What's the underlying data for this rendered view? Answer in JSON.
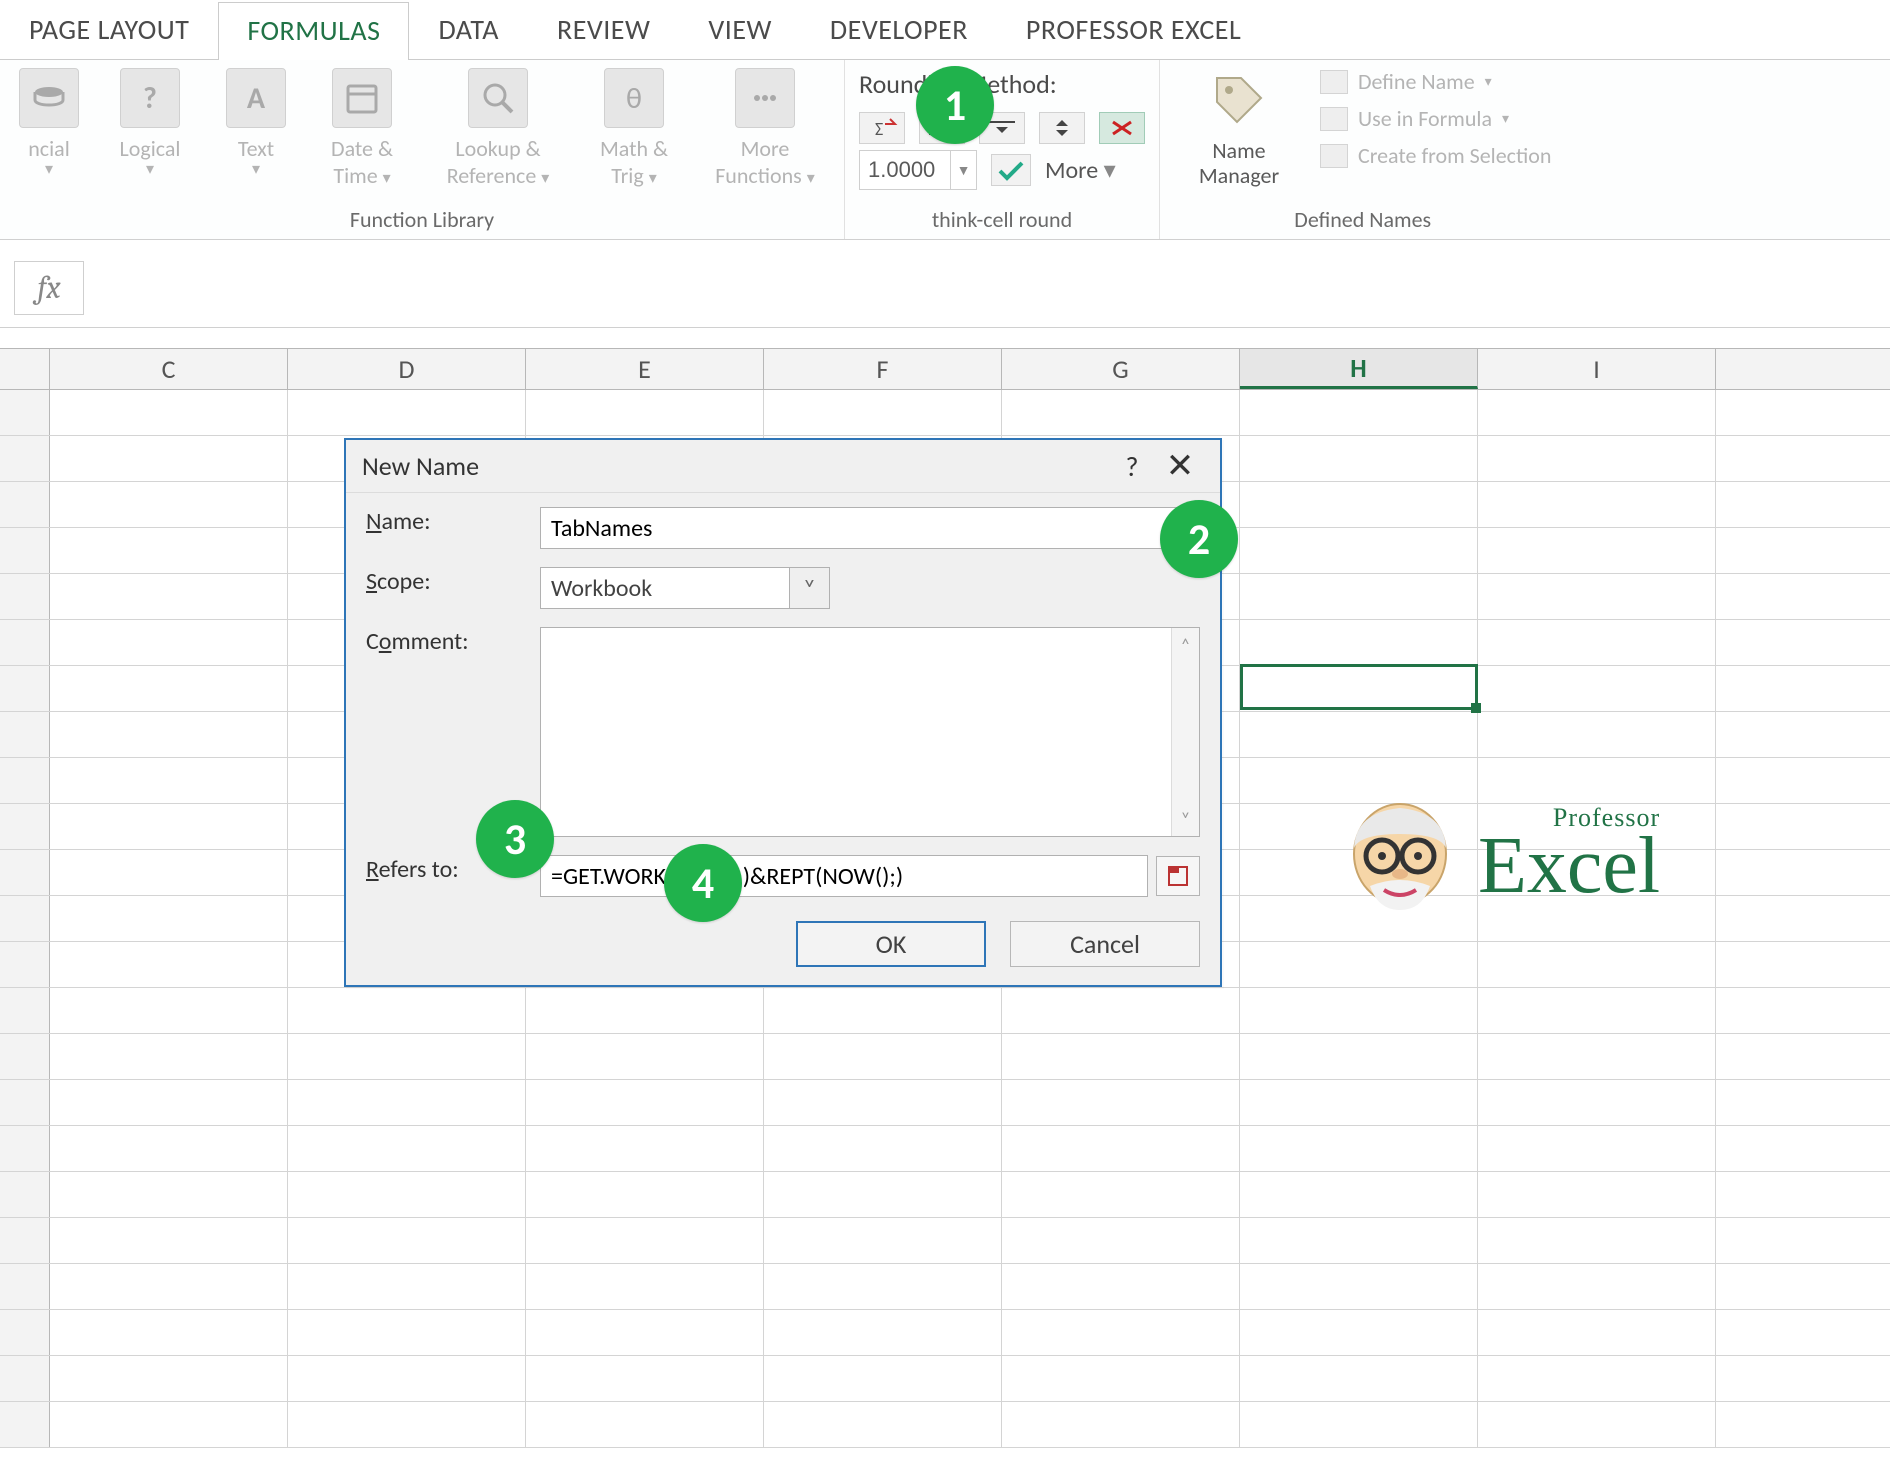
{
  "ribbon_tabs": {
    "page_layout": "PAGE LAYOUT",
    "formulas": "FORMULAS",
    "data": "DATA",
    "review": "REVIEW",
    "view": "VIEW",
    "developer": "DEVELOPER",
    "professor_excel": "PROFESSOR EXCEL"
  },
  "fn_library": {
    "financial": "ncial",
    "logical": "Logical",
    "text": "Text",
    "date_time_l1": "Date &",
    "date_time_l2": "Time",
    "lookup_l1": "Lookup &",
    "lookup_l2": "Reference",
    "math_l1": "Math &",
    "math_l2": "Trig",
    "more_l1": "More",
    "more_l2": "Functions",
    "group_label": "Function Library"
  },
  "thinkcell": {
    "title": "Rounding Method:",
    "precision": "1.0000",
    "more": "More",
    "group_label": "think-cell round"
  },
  "defined_names": {
    "name_mgr_l1": "Name",
    "name_mgr_l2": "Manager",
    "define_name": "Define Name",
    "use_in_formula": "Use in Formula",
    "create_selection": "Create from Selection",
    "group_label": "Defined Names"
  },
  "formula_bar": {
    "fx": "fx",
    "value": ""
  },
  "columns": [
    "C",
    "D",
    "E",
    "F",
    "G",
    "H",
    "I"
  ],
  "active_column": "H",
  "dialog": {
    "title": "New Name",
    "help": "?",
    "close": "×",
    "name_label_html": "Name:",
    "name_value": "TabNames",
    "scope_label_html": "Scope:",
    "scope_value": "Workbook",
    "comment_label_html": "Comment:",
    "refers_label_html": "Refers to:",
    "refers_value": "=GET.WORKBOOK(1)&REPT(NOW();)",
    "ok": "OK",
    "cancel": "Cancel"
  },
  "callouts": {
    "c1": "1",
    "c2": "2",
    "c3": "3",
    "c4": "4"
  },
  "logo": {
    "small": "Professor",
    "big": "Excel"
  }
}
